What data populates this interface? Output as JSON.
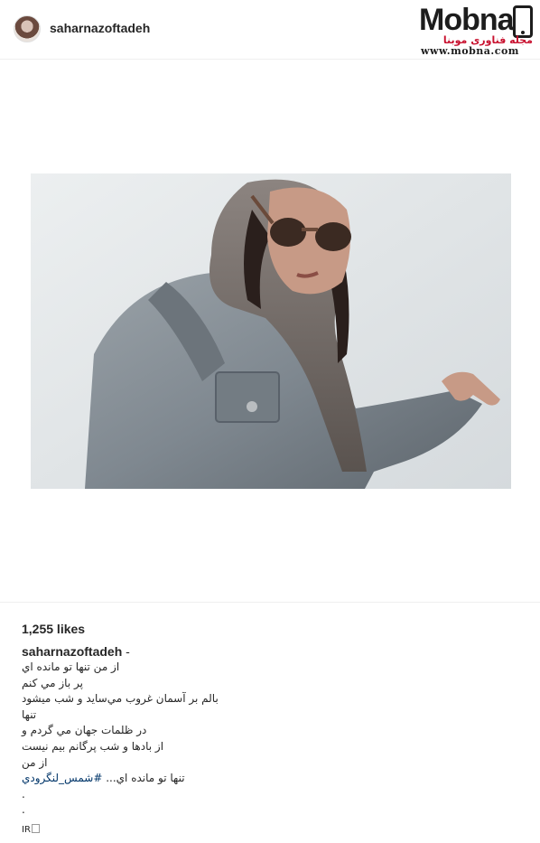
{
  "header": {
    "username": "saharnazoftadeh"
  },
  "watermark": {
    "word_start": "Mob",
    "word_end": "na",
    "tagline": "مجله فناوری موبنا",
    "url": "www.mobna.com"
  },
  "post": {
    "image_alt": "woman in headscarf, sunglasses and denim jacket",
    "colors": {
      "background": "#dfe3e5",
      "denim": "#7f8890",
      "scarf": "#6d6560",
      "hair": "#2a1f1c",
      "skin": "#c79a86"
    }
  },
  "footer": {
    "likes": "1,255 likes",
    "caption_user": "saharnazoftadeh",
    "caption_dash": "-",
    "caption_lines": [
      "از من تنها تو مانده اي",
      "پر باز مي كنم",
      "بالم بر آسمان غروب مي‌سايد و شب ميشود",
      "تنها",
      "در ظلمات جهان مي گردم و",
      "از بادها و شب پرگانم بيم نيست",
      "از من",
      "تنها تو مانده اي... ",
      ".",
      "."
    ],
    "hashtag": "#شمس_لنگرودي",
    "suffix": "IR"
  }
}
